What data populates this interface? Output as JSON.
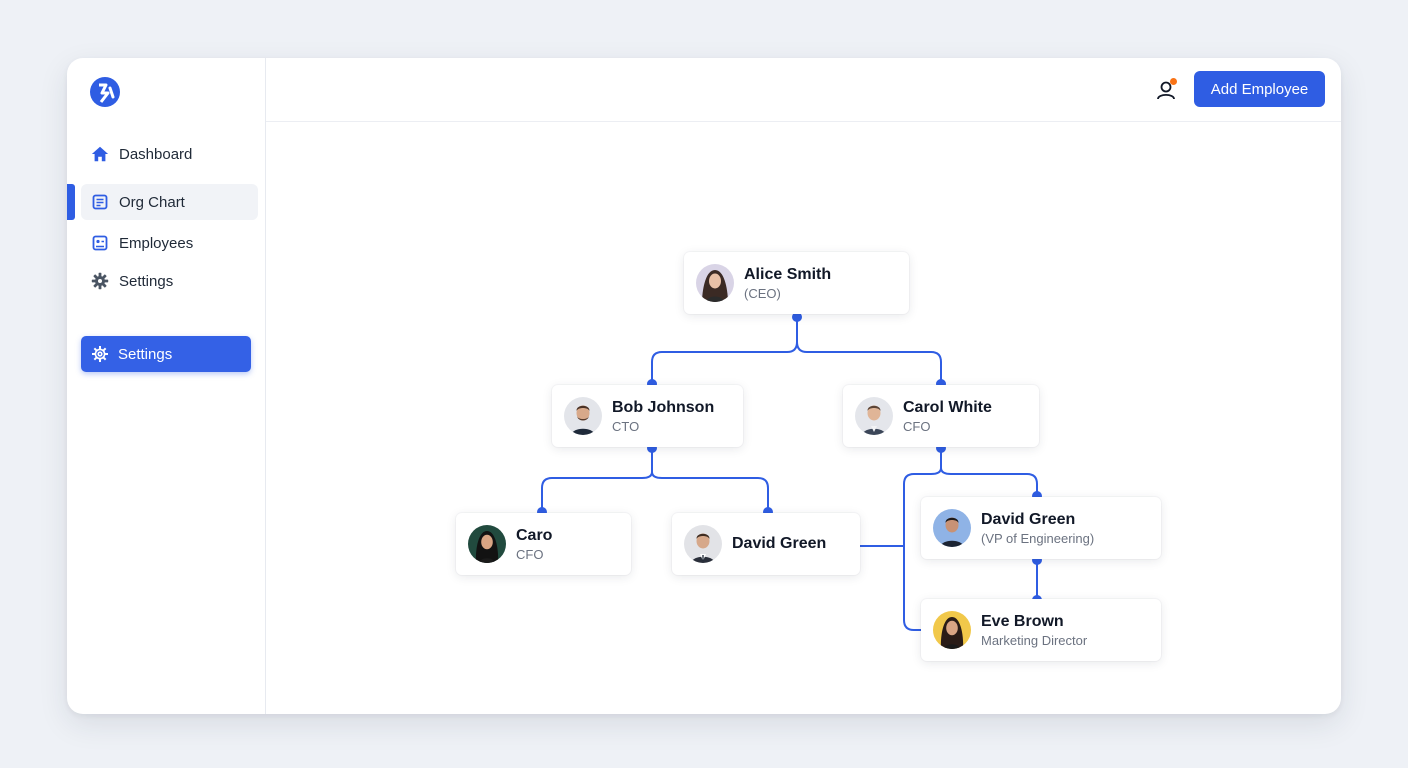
{
  "brand": {
    "accent": "#2f5de3",
    "notification_color": "#f97316"
  },
  "sidebar": {
    "items": [
      {
        "label": "Dashboard",
        "icon": "home-icon"
      },
      {
        "label": "Org Chart",
        "icon": "org-chart-icon",
        "active": true
      },
      {
        "label": "Employees",
        "icon": "employees-icon"
      },
      {
        "label": "Settings",
        "icon": "gear-icon"
      }
    ],
    "settings_button": {
      "label": "Settings",
      "icon": "gear-icon"
    }
  },
  "header": {
    "user_icon": "user-icon",
    "add_button": "Add Employee"
  },
  "org_chart": {
    "people": [
      {
        "id": "alice",
        "name": "Alice Smith",
        "role": "(CEO)"
      },
      {
        "id": "bob",
        "name": "Bob Johnson",
        "role": "CTO"
      },
      {
        "id": "carol",
        "name": "Carol White",
        "role": "CFO"
      },
      {
        "id": "caro",
        "name": "Caro",
        "role": "CFO"
      },
      {
        "id": "david1",
        "name": "David Green",
        "role": ""
      },
      {
        "id": "david2",
        "name": "David Green",
        "role": "(VP of Engineering)"
      },
      {
        "id": "eve",
        "name": "Eve Brown",
        "role": "Marketing Director"
      }
    ]
  }
}
